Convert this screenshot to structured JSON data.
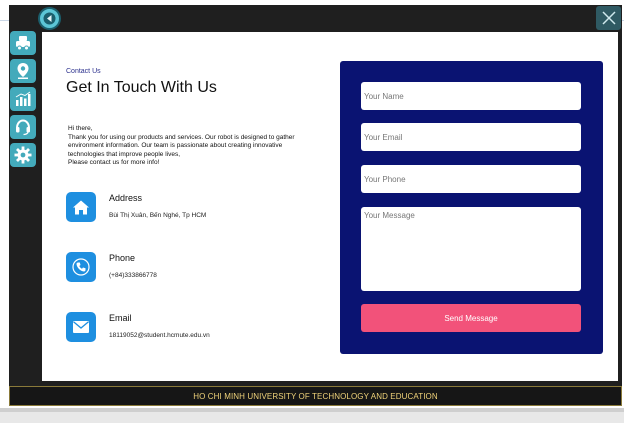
{
  "colors": {
    "accent": "#43aabb",
    "form_panel": "#0a1372",
    "send_button": "#f2527a",
    "info_icon": "#1e8fe0",
    "footer_text": "#f0d37a"
  },
  "window": {
    "back_icon": "back-arrow-icon",
    "close_icon": "close-icon"
  },
  "sidebar": {
    "items": [
      {
        "id": "vehicle",
        "icon": "robot-car-icon"
      },
      {
        "id": "location",
        "icon": "map-pin-icon"
      },
      {
        "id": "charts",
        "icon": "bar-chart-icon"
      },
      {
        "id": "support",
        "icon": "headset-icon"
      },
      {
        "id": "settings",
        "icon": "gear-icon"
      }
    ]
  },
  "contact": {
    "eyebrow": "Contact Us",
    "title": "Get In Touch With Us",
    "intro": [
      "Hi there,",
      "Thank you for using our products and services. Our robot is designed to gather environment information. Our team is passionate about creating innovative technologies that improve people lives,",
      "Please contact us for more info!"
    ],
    "address": {
      "title": "Address",
      "value": "Bùi Thị Xuân, Bến Nghé, Tp HCM",
      "icon": "home-icon"
    },
    "phone": {
      "title": "Phone",
      "value": "(+84)333866778",
      "icon": "phone-icon"
    },
    "email": {
      "title": "Email",
      "value": "18119052@student.hcmute.edu.vn",
      "icon": "mail-icon"
    }
  },
  "form": {
    "name_placeholder": "Your Name",
    "email_placeholder": "Your Email",
    "phone_placeholder": "Your Phone",
    "message_placeholder": "Your Message",
    "send_label": "Send Message"
  },
  "footer": {
    "text": "HO CHI MINH UNIVERSITY OF TECHNOLOGY AND EDUCATION"
  }
}
